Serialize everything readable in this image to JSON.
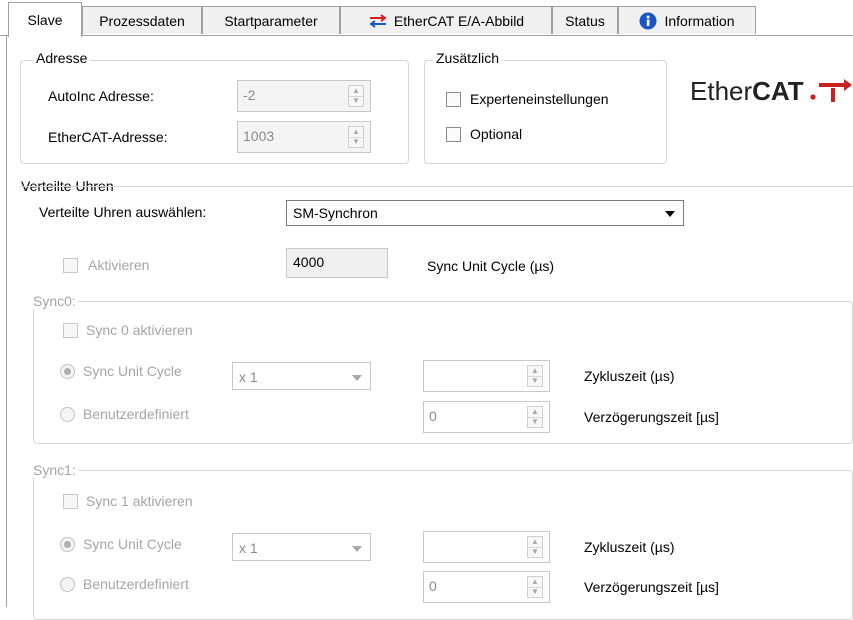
{
  "tabs": [
    {
      "label": "Slave",
      "active": true
    },
    {
      "label": "Prozessdaten"
    },
    {
      "label": "Startparameter"
    },
    {
      "label": "EtherCAT E/A-Abbild",
      "icon": "io-arrows-icon"
    },
    {
      "label": "Status"
    },
    {
      "label": "Information",
      "icon": "info-icon"
    }
  ],
  "address": {
    "legend": "Adresse",
    "autoinc_label": "AutoInc Adresse:",
    "autoinc_value": "-2",
    "ethercat_label": "EtherCAT-Adresse:",
    "ethercat_value": "1003"
  },
  "additional": {
    "legend": "Zusätzlich",
    "expert_label": "Experteneinstellungen",
    "optional_label": "Optional"
  },
  "logo": {
    "light": "Ether",
    "bold": "CAT"
  },
  "dc": {
    "legend": "Verteilte Uhren",
    "select_label": "Verteilte Uhren auswählen:",
    "select_value": "SM-Synchron",
    "activate_label": "Aktivieren",
    "cycle_value": "4000",
    "cycle_label": "Sync Unit Cycle (µs)"
  },
  "sync0": {
    "legend": "Sync0:",
    "activate_label": "Sync 0 aktivieren",
    "unit_cycle_label": "Sync Unit Cycle",
    "factor_value": "x 1",
    "cycle_time_value": "",
    "cycle_time_label": "Zykluszeit (µs)",
    "custom_label": "Benutzerdefiniert",
    "delay_value": "0",
    "delay_label": "Verzögerungszeit [µs]"
  },
  "sync1": {
    "legend": "Sync1:",
    "activate_label": "Sync 1 aktivieren",
    "unit_cycle_label": "Sync Unit Cycle",
    "factor_value": "x 1",
    "cycle_time_value": "",
    "cycle_time_label": "Zykluszeit (µs)",
    "custom_label": "Benutzerdefiniert",
    "delay_value": "0",
    "delay_label": "Verzögerungszeit [µs]"
  },
  "colors": {
    "accent_blue": "#1a56c8",
    "arrow_red": "#d42020",
    "logo_red": "#cc1f1f"
  }
}
